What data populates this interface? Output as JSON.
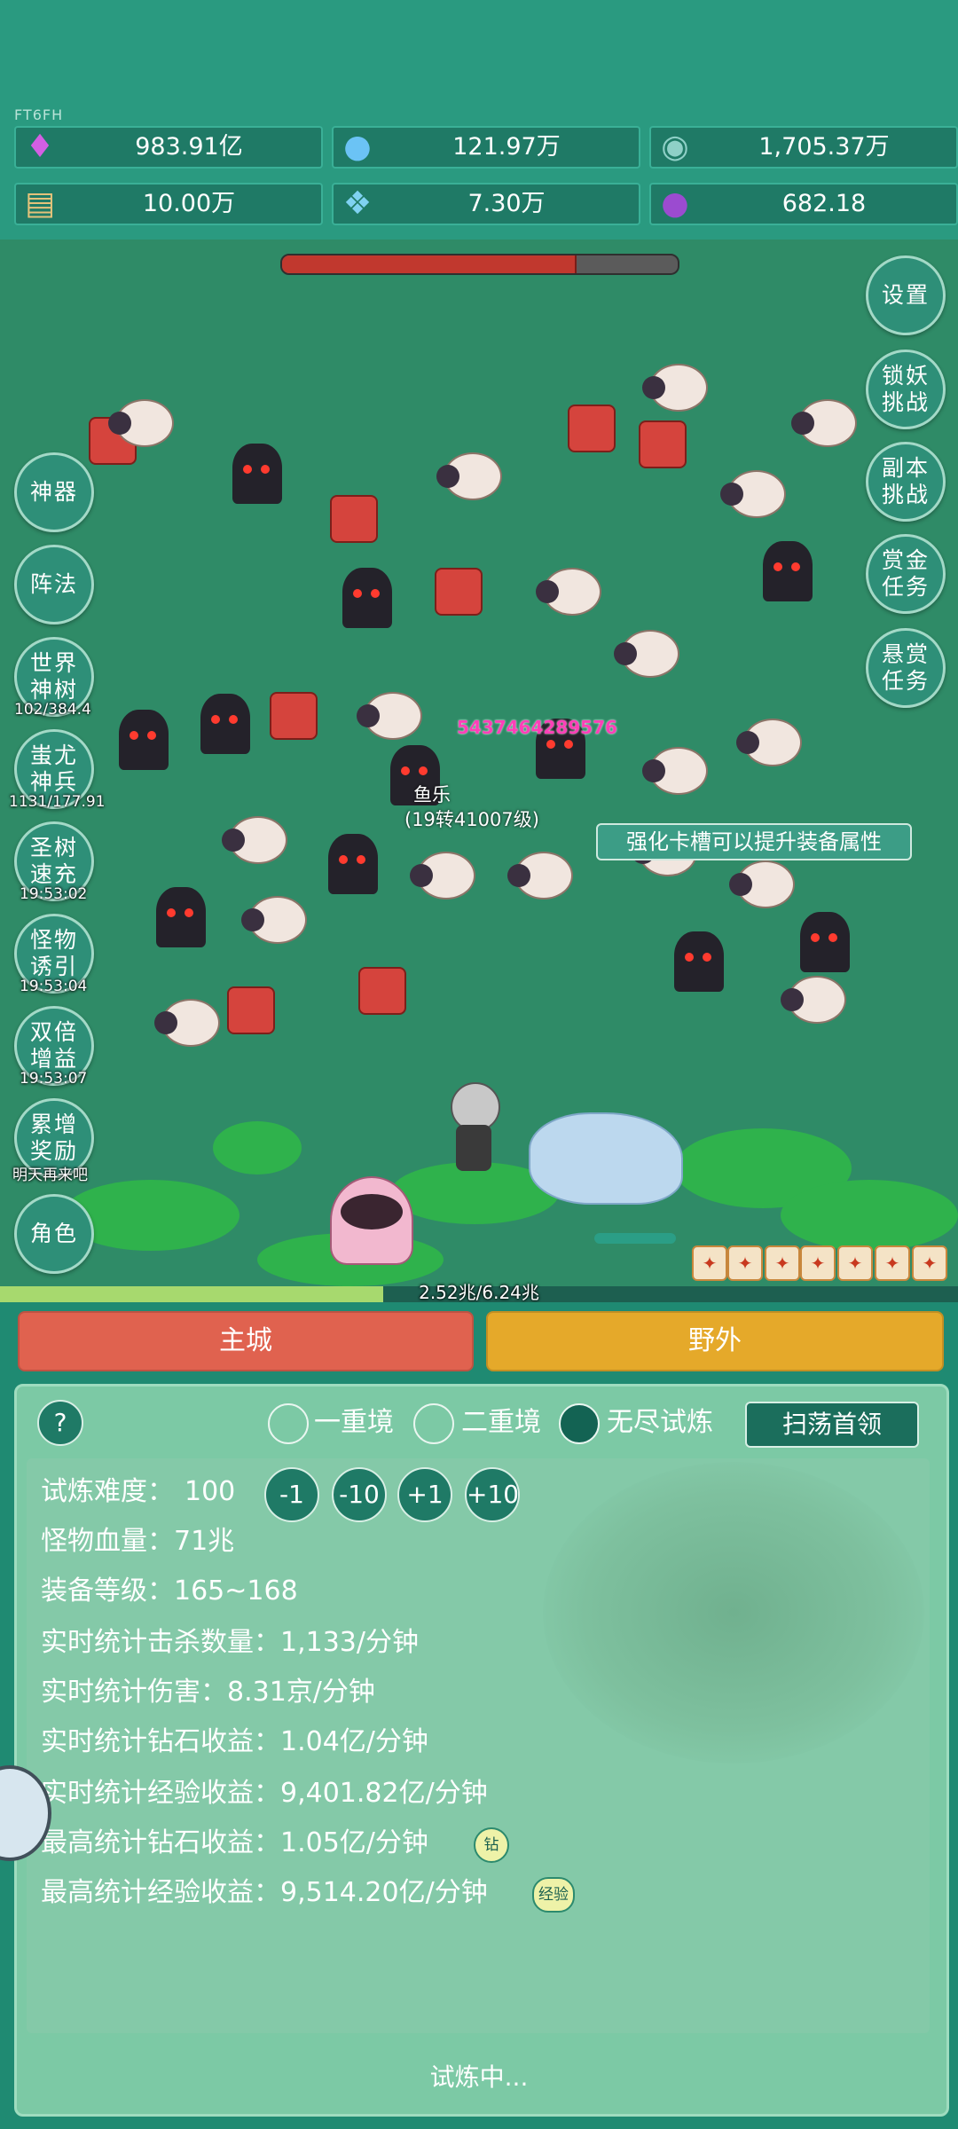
{
  "header": {
    "small_tag": "FT6FH",
    "resources": [
      {
        "icon": "diamond-icon",
        "value": "983.91亿"
      },
      {
        "icon": "crystal-orb-icon",
        "value": "121.97万"
      },
      {
        "icon": "globe-orb-icon",
        "value": "1,705.37万"
      },
      {
        "icon": "scroll-icon",
        "value": "10.00万"
      },
      {
        "icon": "ice-crystal-icon",
        "value": "7.30万"
      },
      {
        "icon": "purple-pouch-icon",
        "value": "682.18"
      }
    ]
  },
  "battle": {
    "enemy_hp_fraction": 0.74,
    "damage_number": "5437464289576",
    "player_name": "鱼乐",
    "player_level": "(19转41007级)",
    "hint": "强化卡槽可以提升装备属性",
    "xp_text": "2.52兆/6.24兆",
    "xp_fraction": 0.4
  },
  "left_menu": [
    {
      "label": "神器"
    },
    {
      "label": "阵法"
    },
    {
      "label": "世界神树",
      "sub": "102/384.4"
    },
    {
      "label": "蚩尤神兵",
      "sub": "1131/177.91"
    },
    {
      "label": "圣树速充",
      "sub": "19:53:02"
    },
    {
      "label": "怪物诱引",
      "sub": "19:53:04"
    },
    {
      "label": "双倍增益",
      "sub": "19:53:07"
    },
    {
      "label": "累增奖励",
      "sub": "明天再来吧"
    },
    {
      "label": "角色"
    }
  ],
  "right_menu": [
    {
      "label": "设置"
    },
    {
      "label": "锁妖挑战"
    },
    {
      "label": "副本挑战"
    },
    {
      "label": "赏金任务"
    },
    {
      "label": "悬赏任务"
    }
  ],
  "tabs": {
    "city": "主城",
    "wild": "野外"
  },
  "panel": {
    "help": "?",
    "modes": [
      "一重境",
      "二重境",
      "无尽试炼"
    ],
    "selected_mode": "无尽试炼",
    "sweep_button": "扫荡首领",
    "difficulty_label": "试炼难度：",
    "difficulty_value": "100",
    "steps": [
      "-1",
      "-10",
      "+1",
      "+10"
    ],
    "stats": [
      "怪物血量：71兆",
      "装备等级：165~168",
      "实时统计击杀数量：1,133/分钟",
      "实时统计伤害：8.31京/分钟",
      "实时统计钻石收益：1.04亿/分钟",
      "实时统计经验收益：9,401.82亿/分钟",
      "最高统计钻石收益：1.05亿/分钟",
      "最高统计经验收益：9,514.20亿/分钟"
    ],
    "badge_diamond": "钻",
    "badge_exp": "经验",
    "footer": "试炼中..."
  }
}
